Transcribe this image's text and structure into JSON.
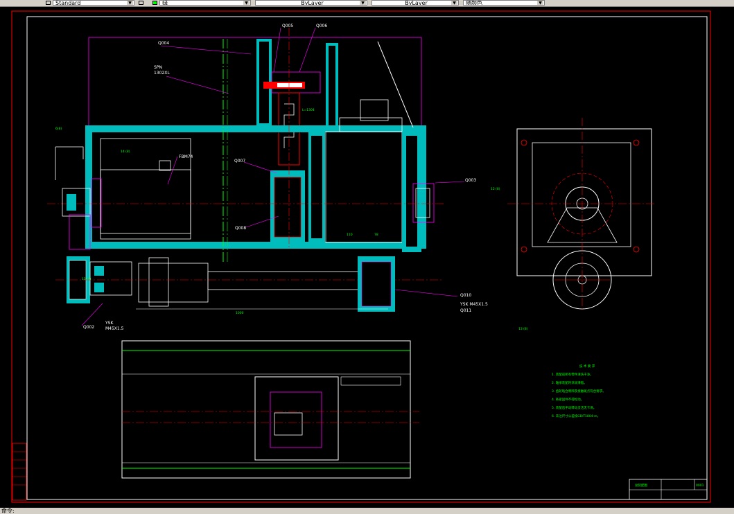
{
  "toolbar": {
    "textstyle_value": "Standard",
    "layer_value": "0",
    "color_value": "绿",
    "color_swatch": "#00ff00",
    "linetype_value": "ByLayer",
    "lineweight_value": "ByLayer",
    "plotstyle_value": "随颜色"
  },
  "drawing": {
    "labels": {
      "g005": "Q005",
      "g006": "Q006",
      "g004": "Q004",
      "spn1": "SPN",
      "spn2": "1302XL",
      "motor": "FBM74",
      "g007": "Q007",
      "g008": "Q008",
      "g003": "Q003",
      "l_dim": "L=1304",
      "g010": "Q010",
      "g011": "Q011",
      "g002": "Q002",
      "ysk_right": "YSK M45X1.5",
      "ysk_left1": "YSK",
      "ysk_left2": "M45X1.5",
      "tiny_110": "110",
      "tiny_78": "78",
      "tiny_6": "6(8)",
      "tiny_14": "14 (8)",
      "tiny_12": "12 (8)",
      "tiny_13": "13 (8)",
      "tiny_15": "15 (4)"
    },
    "notes": {
      "title": "技 术 要 求",
      "lines": [
        "1. 装配前所有零件清洗干净。",
        "2. 轴承装配时涂润滑脂。",
        "3. 齿轮啮合侧隙及接触斑点符合要求。",
        "4. 各紧固件不得松动。",
        "5. 装配后手动转动灵活无卡滞。",
        "6. 未注尺寸公差按GB/T1804-m。"
      ]
    },
    "title_block": {
      "title": "总装配图",
      "number": "0001"
    }
  },
  "command_line": "命令:"
}
